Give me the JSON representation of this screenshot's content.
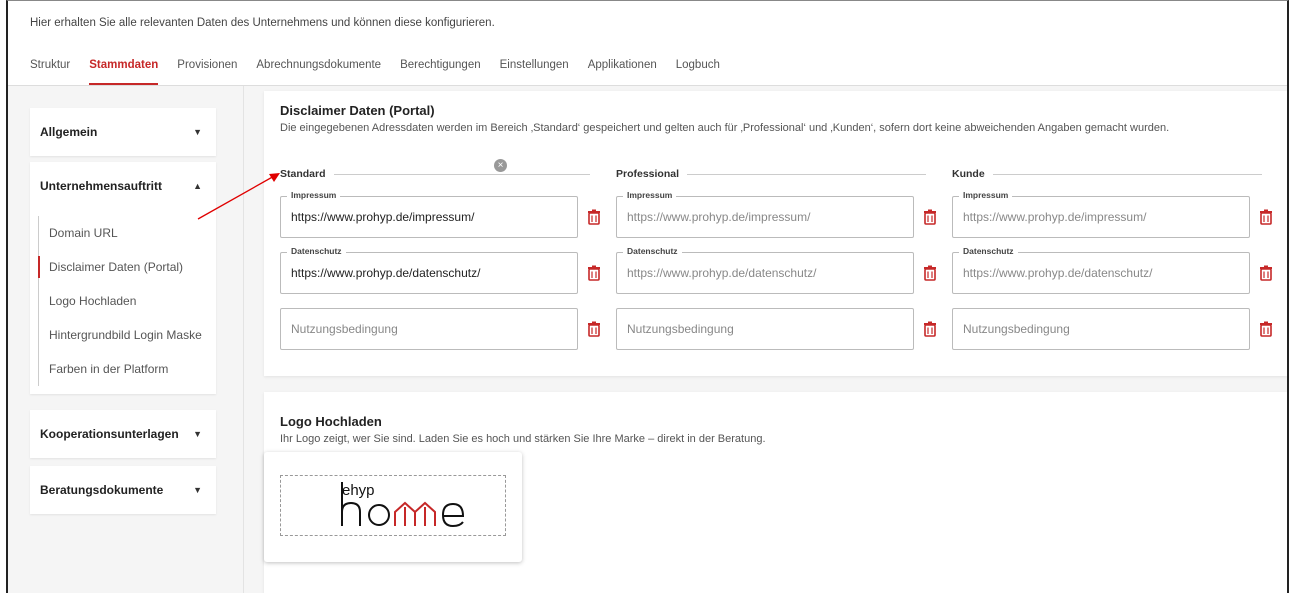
{
  "intro": "Hier erhalten Sie alle relevanten Daten des Unternehmens und können diese konfigurieren.",
  "tabs": [
    {
      "label": "Struktur",
      "active": false
    },
    {
      "label": "Stammdaten",
      "active": true
    },
    {
      "label": "Provisionen",
      "active": false
    },
    {
      "label": "Abrechnungsdokumente",
      "active": false
    },
    {
      "label": "Berechtigungen",
      "active": false
    },
    {
      "label": "Einstellungen",
      "active": false
    },
    {
      "label": "Applikationen",
      "active": false
    },
    {
      "label": "Logbuch",
      "active": false
    }
  ],
  "sidebar": {
    "sections": [
      {
        "label": "Allgemein",
        "icon": "chevron-down-icon"
      },
      {
        "label": "Unternehmensauftritt",
        "icon": "chevron-up-icon"
      },
      {
        "label": "Kooperationsunterlagen",
        "icon": "chevron-down-icon"
      },
      {
        "label": "Beratungsdokumente",
        "icon": "chevron-down-icon"
      }
    ],
    "sub_items": [
      {
        "label": "Domain URL",
        "active": false
      },
      {
        "label": "Disclaimer Daten (Portal)",
        "active": true
      },
      {
        "label": "Logo Hochladen",
        "active": false
      },
      {
        "label": "Hintergrundbild Login Maske",
        "active": false
      },
      {
        "label": "Farben in der Platform",
        "active": false
      }
    ]
  },
  "disclaimer": {
    "title": "Disclaimer Daten (Portal)",
    "description": "Die eingegebenen Adressdaten werden im Bereich ‚Standard‘ gespeichert und gelten auch für ‚Professional‘ und ‚Kunden‘, sofern dort keine abweichenden Angaben gemacht wurden.",
    "columns": [
      {
        "heading": "Standard",
        "fields": [
          {
            "label": "Impressum",
            "value": "https://www.prohyp.de/impressum/",
            "placeholder": false
          },
          {
            "label": "Datenschutz",
            "value": "https://www.prohyp.de/datenschutz/",
            "placeholder": false
          },
          {
            "label": "",
            "value": "Nutzungsbedingung",
            "placeholder": true
          }
        ]
      },
      {
        "heading": "Professional",
        "fields": [
          {
            "label": "Impressum",
            "value": "https://www.prohyp.de/impressum/",
            "placeholder": true
          },
          {
            "label": "Datenschutz",
            "value": "https://www.prohyp.de/datenschutz/",
            "placeholder": true
          },
          {
            "label": "",
            "value": "Nutzungsbedingung",
            "placeholder": true
          }
        ]
      },
      {
        "heading": "Kunde",
        "fields": [
          {
            "label": "Impressum",
            "value": "https://www.prohyp.de/impressum/",
            "placeholder": true
          },
          {
            "label": "Datenschutz",
            "value": "https://www.prohyp.de/datenschutz/",
            "placeholder": true
          },
          {
            "label": "",
            "value": "Nutzungsbedingung",
            "placeholder": true
          }
        ]
      }
    ]
  },
  "logo_section": {
    "title": "Logo Hochladen",
    "description": "Ihr Logo zeigt, wer Sie sind. Laden Sie es hoch und stärken Sie Ihre Marke – direkt in der Beratung.",
    "logo_text_top": "ehyp",
    "logo_text_main": "home",
    "close_icon": "close-icon"
  },
  "colors": {
    "accent": "#c62828",
    "trash": "#c62828"
  }
}
